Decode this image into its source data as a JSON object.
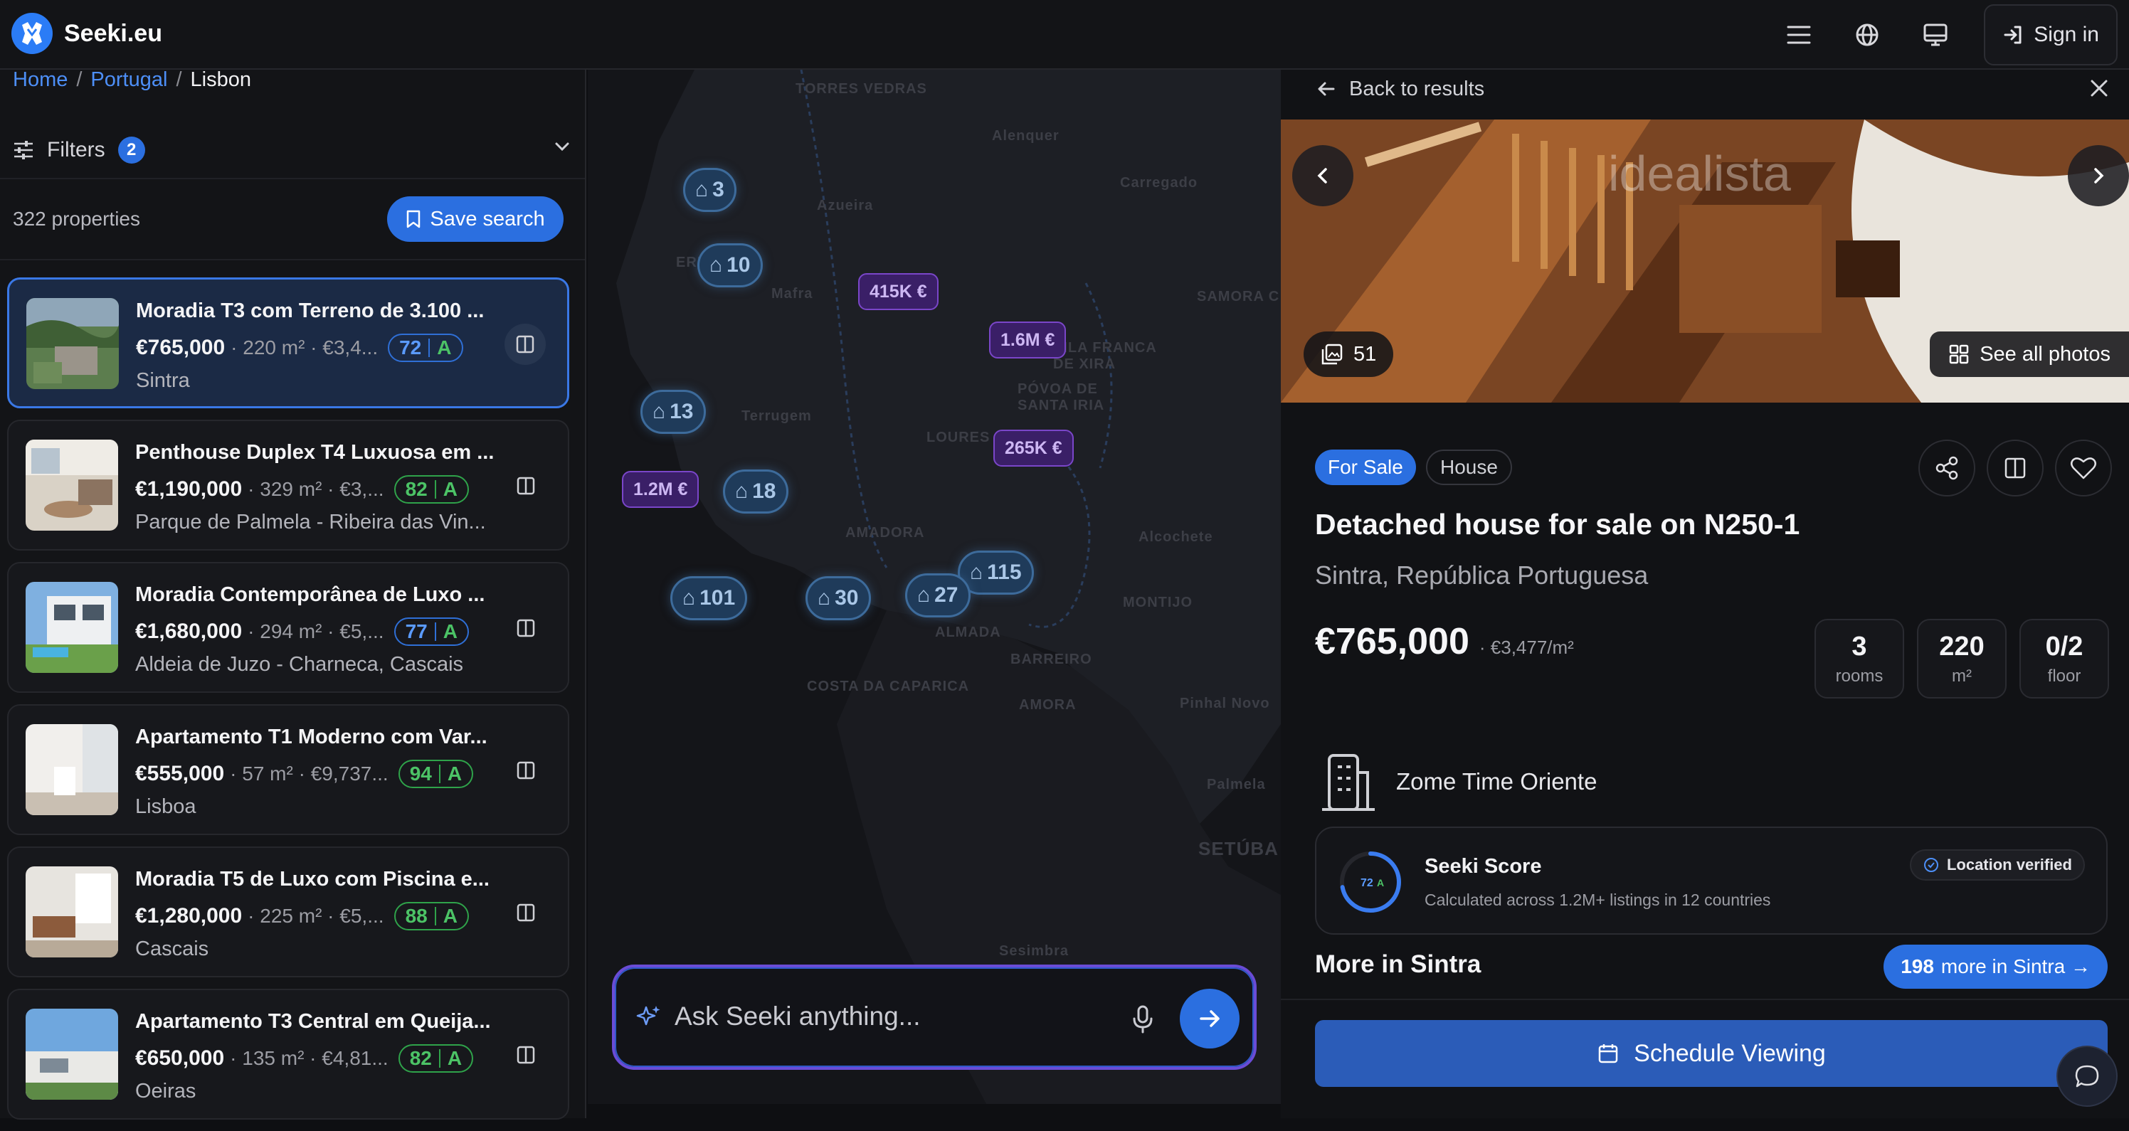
{
  "app": {
    "name": "Seeki.eu",
    "sign_in": "Sign in"
  },
  "breadcrumb": {
    "home": "Home",
    "sep1": "/",
    "country": "Portugal",
    "sep2": "/",
    "city": "Lisbon"
  },
  "filters": {
    "label": "Filters",
    "count": "2"
  },
  "results": {
    "count_text": "322 properties",
    "save_search": "Save search"
  },
  "listings": [
    {
      "title": "Moradia T3 com Terreno de 3.100 ...",
      "price": "€765,000",
      "meta": "· 220 m² · €3,4...",
      "score": "72",
      "grade": "A",
      "location": "Sintra"
    },
    {
      "title": "Penthouse Duplex T4 Luxuosa em ...",
      "price": "€1,190,000",
      "meta": "· 329 m² · €3,...",
      "score": "82",
      "grade": "A",
      "location": "Parque de Palmela - Ribeira das Vin..."
    },
    {
      "title": "Moradia Contemporânea de Luxo ...",
      "price": "€1,680,000",
      "meta": "· 294 m² · €5,...",
      "score": "77",
      "grade": "A",
      "location": "Aldeia de Juzo - Charneca, Cascais"
    },
    {
      "title": "Apartamento T1 Moderno com Var...",
      "price": "€555,000",
      "meta": "· 57 m² · €9,737...",
      "score": "94",
      "grade": "A",
      "location": "Lisboa"
    },
    {
      "title": "Moradia T5 de Luxo com Piscina e...",
      "price": "€1,280,000",
      "meta": "· 225 m² · €5,...",
      "score": "88",
      "grade": "A",
      "location": "Cascais"
    },
    {
      "title": "Apartamento T3 Central em Queija...",
      "price": "€650,000",
      "meta": "· 135 m² · €4,81...",
      "score": "82",
      "grade": "A",
      "location": "Oeiras"
    }
  ],
  "map": {
    "clusters": [
      "3",
      "10",
      "13",
      "18",
      "101",
      "30",
      "27",
      "115"
    ],
    "price_markers": [
      "415K €",
      "1.6M €",
      "265K €",
      "1.2M €"
    ],
    "place_labels": [
      "TORRES VEDRAS",
      "Alenquer",
      "Azueira",
      "Carregado",
      "Mafra",
      "SAMORA C",
      "ERICEIRA",
      "VILA FRANCA DE XIRA",
      "PÓVOA DE SANTA IRIA",
      "Terrugem",
      "LOURES",
      "AMADORA",
      "Alcochete",
      "MONTIJO",
      "ALMADA",
      "BARREIRO",
      "COSTA DA CAPARICA",
      "AMORA",
      "Pinhal Novo",
      "Palmela",
      "SETÚBA",
      "Sesimbra"
    ]
  },
  "ask": {
    "placeholder": "Ask Seeki anything..."
  },
  "detail": {
    "back": "Back to results",
    "photo_count": "51",
    "see_all": "See all photos",
    "tag_sale": "For Sale",
    "tag_type": "House",
    "title": "Detached house for sale on N250-1",
    "subtitle": "Sintra, República Portuguesa",
    "price": "€765,000",
    "price_per": "· €3,477/m²",
    "stats": [
      {
        "value": "3",
        "label": "rooms"
      },
      {
        "value": "220",
        "label": "m²"
      },
      {
        "value": "0/2",
        "label": "floor"
      }
    ],
    "agency": "Zome Time Oriente",
    "score": {
      "title": "Seeki Score",
      "subtitle": "Calculated across 1.2M+ listings in 12 countries",
      "value": "72",
      "grade": "A",
      "verified": "Location verified"
    },
    "more_title": "More in Sintra",
    "more_count": "198",
    "more_text": "more in Sintra →",
    "schedule": "Schedule Viewing"
  },
  "colors": {
    "accent": "#2b6fe0",
    "score_blue": "#5b9bff",
    "score_green": "#4cc366",
    "price_marker": "#3a1f67"
  }
}
